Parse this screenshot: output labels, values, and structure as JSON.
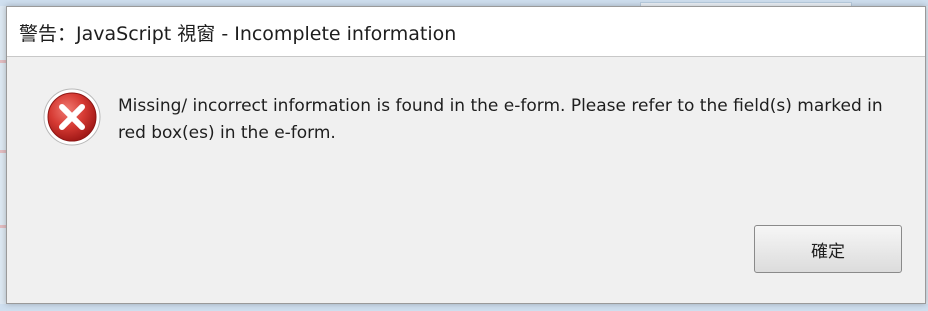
{
  "dialog": {
    "title": "警告：JavaScript 視窗 - Incomplete information",
    "message": "Missing/ incorrect information is found in the e-form. Please refer to the field(s) marked in red box(es) in the e-form.",
    "icon": "error-icon",
    "ok_label": "確定"
  },
  "colors": {
    "error_red": "#c8262a",
    "dialog_background": "#f0f0f0",
    "title_background": "#ffffff"
  }
}
